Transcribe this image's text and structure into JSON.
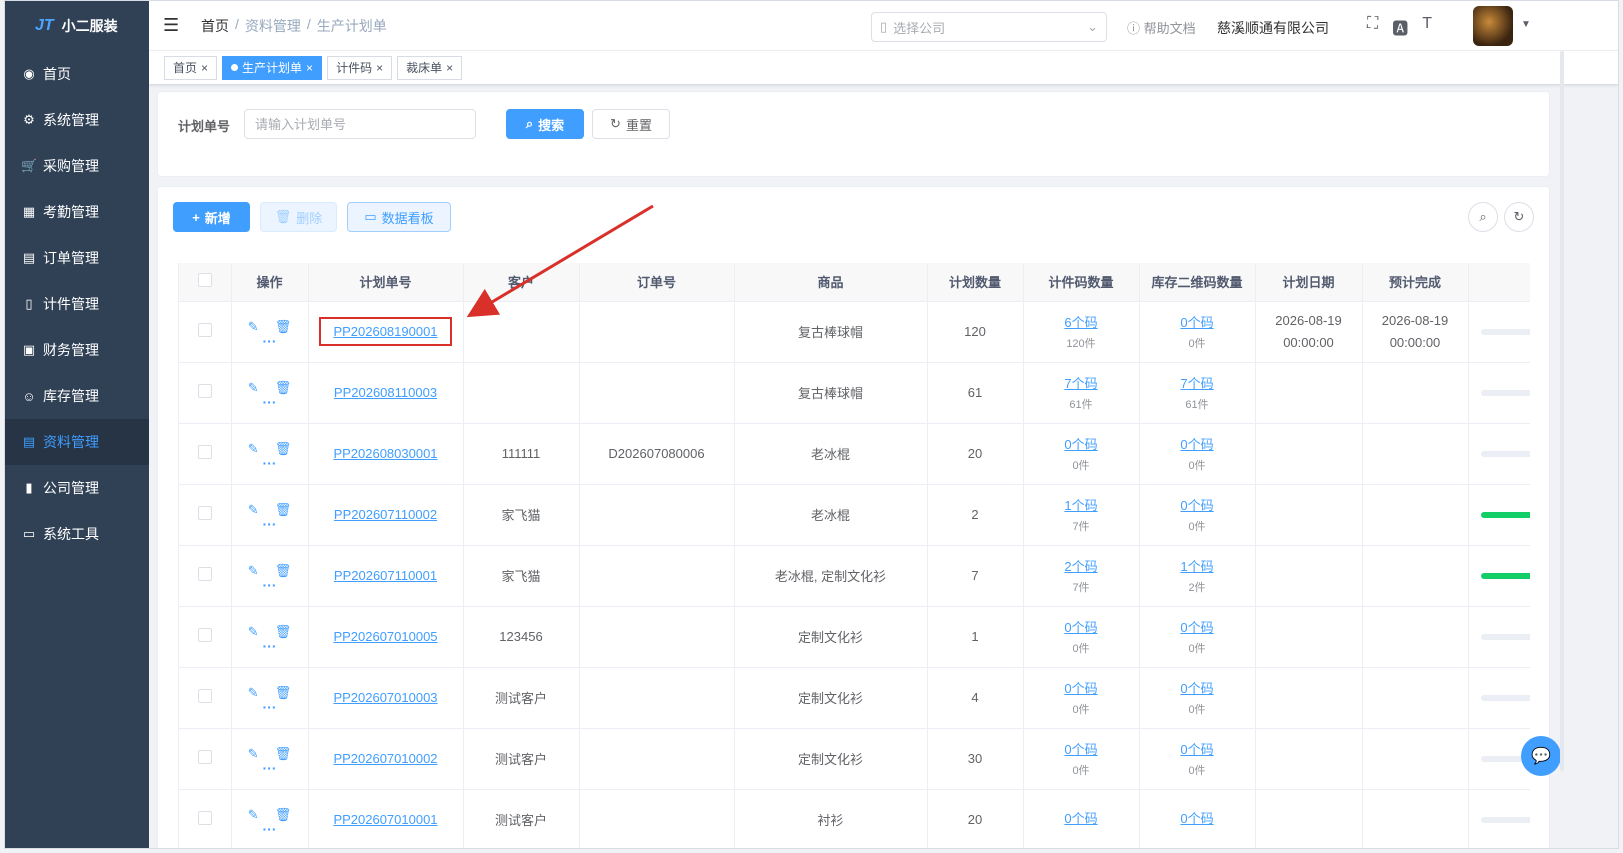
{
  "app": {
    "logo_mark": "JT",
    "name": "小二服装"
  },
  "sidebar": {
    "items": [
      {
        "label": "首页",
        "icon": "dashboard-icon"
      },
      {
        "label": "系统管理",
        "icon": "gear-icon"
      },
      {
        "label": "采购管理",
        "icon": "cart-icon"
      },
      {
        "label": "考勤管理",
        "icon": "grid-icon"
      },
      {
        "label": "订单管理",
        "icon": "order-icon"
      },
      {
        "label": "计件管理",
        "icon": "book-icon"
      },
      {
        "label": "财务管理",
        "icon": "chart-icon"
      },
      {
        "label": "库存管理",
        "icon": "user-icon"
      },
      {
        "label": "资料管理",
        "icon": "document-icon",
        "active": true
      },
      {
        "label": "公司管理",
        "icon": "bar-chart-icon"
      },
      {
        "label": "系统工具",
        "icon": "toolbox-icon"
      }
    ]
  },
  "navbar": {
    "breadcrumb": [
      "首页",
      "资料管理",
      "生产计划单"
    ],
    "breadcrumb_sep": "/",
    "company_placeholder": "选择公司",
    "help": "帮助文档",
    "company_name": "慈溪顺通有限公司"
  },
  "tags": [
    {
      "label": "首页",
      "active": false
    },
    {
      "label": "生产计划单",
      "active": true
    },
    {
      "label": "计件码",
      "active": false
    },
    {
      "label": "裁床单",
      "active": false
    }
  ],
  "search": {
    "label": "计划单号",
    "placeholder": "请输入计划单号",
    "search_btn": "搜索",
    "reset_btn": "重置"
  },
  "toolbar": {
    "add": "新增",
    "delete": "删除",
    "dashboard": "数据看板"
  },
  "table": {
    "headers": [
      "",
      "操作",
      "计划单号",
      "客户",
      "订单号",
      "商品",
      "计划数量",
      "计件码数量",
      "库存二维码数量",
      "计划日期",
      "预计完成",
      ""
    ],
    "rows": [
      {
        "plan_no": "PP202608190001",
        "customer": "",
        "order_no": "",
        "product": "复古棒球帽",
        "qty": "120",
        "piece_codes": "6个码",
        "piece_count": "120件",
        "stock_codes": "0个码",
        "stock_count": "0件",
        "plan_date": "2026-08-19",
        "plan_time": "00:00:00",
        "finish_date": "2026-08-19",
        "finish_time": "00:00:00",
        "progress": 0,
        "highlighted": true
      },
      {
        "plan_no": "PP202608110003",
        "customer": "",
        "order_no": "",
        "product": "复古棒球帽",
        "qty": "61",
        "piece_codes": "7个码",
        "piece_count": "61件",
        "stock_codes": "7个码",
        "stock_count": "61件",
        "plan_date": "",
        "plan_time": "",
        "finish_date": "",
        "finish_time": "",
        "progress": 0
      },
      {
        "plan_no": "PP202608030001",
        "customer": "111111",
        "order_no": "D202607080006",
        "product": "老冰棍",
        "qty": "20",
        "piece_codes": "0个码",
        "piece_count": "0件",
        "stock_codes": "0个码",
        "stock_count": "0件",
        "plan_date": "",
        "plan_time": "",
        "finish_date": "",
        "finish_time": "",
        "progress": 0
      },
      {
        "plan_no": "PP202607110002",
        "customer": "家飞猫",
        "order_no": "",
        "product": "老冰棍",
        "qty": "2",
        "piece_codes": "1个码",
        "piece_count": "7件",
        "stock_codes": "0个码",
        "stock_count": "0件",
        "plan_date": "",
        "plan_time": "",
        "finish_date": "",
        "finish_time": "",
        "progress": 100
      },
      {
        "plan_no": "PP202607110001",
        "customer": "家飞猫",
        "order_no": "",
        "product": "老冰棍, 定制文化衫",
        "qty": "7",
        "piece_codes": "2个码",
        "piece_count": "7件",
        "stock_codes": "1个码",
        "stock_count": "2件",
        "plan_date": "",
        "plan_time": "",
        "finish_date": "",
        "finish_time": "",
        "progress": 100
      },
      {
        "plan_no": "PP202607010005",
        "customer": "123456",
        "order_no": "",
        "product": "定制文化衫",
        "qty": "1",
        "piece_codes": "0个码",
        "piece_count": "0件",
        "stock_codes": "0个码",
        "stock_count": "0件",
        "plan_date": "",
        "plan_time": "",
        "finish_date": "",
        "finish_time": "",
        "progress": 0
      },
      {
        "plan_no": "PP202607010003",
        "customer": "测试客户",
        "order_no": "",
        "product": "定制文化衫",
        "qty": "4",
        "piece_codes": "0个码",
        "piece_count": "0件",
        "stock_codes": "0个码",
        "stock_count": "0件",
        "plan_date": "",
        "plan_time": "",
        "finish_date": "",
        "finish_time": "",
        "progress": 0
      },
      {
        "plan_no": "PP202607010002",
        "customer": "测试客户",
        "order_no": "",
        "product": "定制文化衫",
        "qty": "30",
        "piece_codes": "0个码",
        "piece_count": "0件",
        "stock_codes": "0个码",
        "stock_count": "0件",
        "plan_date": "",
        "plan_time": "",
        "finish_date": "",
        "finish_time": "",
        "progress": 0
      },
      {
        "plan_no": "PP202607010001",
        "customer": "测试客户",
        "order_no": "",
        "product": "衬衫",
        "qty": "20",
        "piece_codes": "0个码",
        "piece_count": "",
        "stock_codes": "0个码",
        "stock_count": "",
        "plan_date": "",
        "plan_time": "",
        "finish_date": "",
        "finish_time": "",
        "progress": 0
      }
    ]
  },
  "colors": {
    "primary": "#409eff",
    "sidebar_bg": "#304156",
    "annotation": "#d9302a",
    "progress_done": "#13ce66"
  }
}
